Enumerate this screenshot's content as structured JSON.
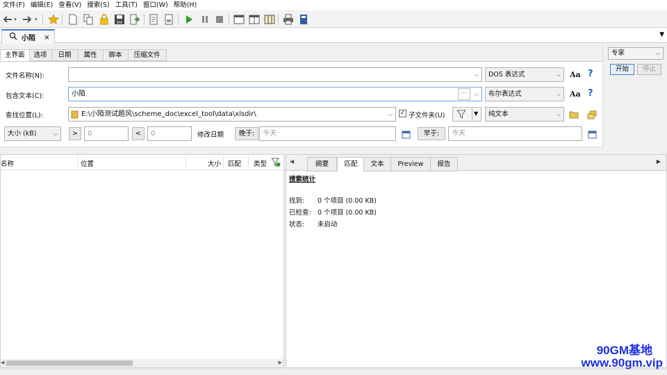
{
  "menu": [
    "文件(F)",
    "编辑(E)",
    "查看(V)",
    "搜索(S)",
    "工具(T)",
    "窗口(W)",
    "帮助(H)"
  ],
  "doc_tab": {
    "label": "小陌",
    "close": "×"
  },
  "search_tabs": [
    "主界面",
    "选项",
    "日期",
    "属性",
    "脚本",
    "压缩文件"
  ],
  "fields": {
    "filename": {
      "label": "文件名称(N):",
      "value": "",
      "mode": "DOS 表达式",
      "case_icon": "Aa",
      "help": "?"
    },
    "content": {
      "label": "包含文本(C):",
      "value": "小陌",
      "more": "···",
      "mode": "布尔表达式",
      "case_icon": "Aa",
      "help": "?"
    },
    "location": {
      "label": "查找位置(L):",
      "value": "E:\\小陌测试题风\\scheme_doc\\excel_tool\\data\\xlsdir\\",
      "subfolders_label": "子文件夹(U)",
      "subfolders_checked": true,
      "type": "纯文本"
    },
    "size": {
      "unit": "大小 (kB)",
      "gt": ">",
      "gt_value": "0",
      "lt": "<",
      "lt_value": "0"
    },
    "date": {
      "label": "修改日期",
      "after_btn": "晚于:",
      "after_value": "今天",
      "before_btn": "早于:",
      "before_value": "今天"
    }
  },
  "right": {
    "profile": "专家",
    "start": "开始",
    "stop": "停止"
  },
  "results": {
    "columns": [
      "名称",
      "位置",
      "大小",
      "匹配",
      "类型"
    ]
  },
  "preview": {
    "tabs": [
      "摘要",
      "匹配",
      "文本",
      "Preview",
      "报告"
    ],
    "title": "搜索统计",
    "rows": [
      {
        "label": "找到:",
        "value": "0 个项目 (0.00 KB)"
      },
      {
        "label": "已检查:",
        "value": "0 个项目 (0.00 KB)"
      },
      {
        "label": "状态:",
        "value": "未启动"
      }
    ]
  },
  "watermark": {
    "line1": "90GM基地",
    "line2": "www.90gm.vip"
  },
  "colors": {
    "accent": "#3c78c8",
    "watermark": "#1d2fe0"
  },
  "icons": [
    "back-arrow-icon",
    "forward-arrow-icon",
    "star-icon",
    "new-doc-icon",
    "copy-icon",
    "lock-icon",
    "save-icon",
    "export-icon",
    "report-icon",
    "page-icon",
    "play-icon",
    "pause-icon",
    "stop-icon",
    "window-icon",
    "layout-icon",
    "columns-icon",
    "print-icon",
    "book-icon",
    "search-icon",
    "filter-icon",
    "folder-icon",
    "calendar-icon"
  ]
}
